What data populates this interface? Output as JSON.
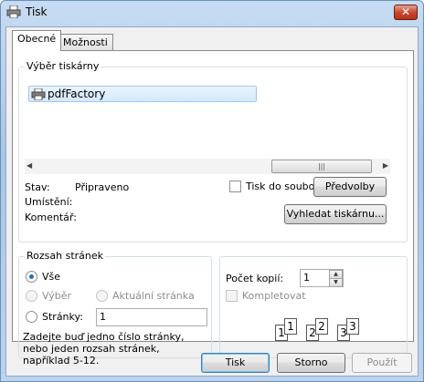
{
  "window": {
    "title": "Tisk",
    "close_glyph": "✕"
  },
  "tabs": [
    {
      "label": "Obecné",
      "active": true
    },
    {
      "label": "Možnosti",
      "active": false
    }
  ],
  "printer_group": {
    "title": "Výběr tiskárny",
    "printers": [
      {
        "label": "pdfFactory",
        "selected": true
      }
    ],
    "scroll_thumb_glyph": "|||",
    "status_label": "Stav:",
    "status_value": "Připraveno",
    "location_label": "Umístění:",
    "comment_label": "Komentář:",
    "print_to_file_label": "Tisk do souboru",
    "print_to_file_checked": false,
    "preferences_button": "Předvolby",
    "find_printer_button": "Vyhledat tiskárnu..."
  },
  "range_group": {
    "title": "Rozsah stránek",
    "all_label": "Vše",
    "selection_label": "Výběr",
    "current_page_label": "Aktuální stránka",
    "pages_label": "Stránky:",
    "pages_value": "1",
    "selected": "all",
    "hint": "Zadejte buď jedno číslo stránky, nebo jeden rozsah stránek, například 5-12."
  },
  "copies_group": {
    "copies_label": "Počet kopií:",
    "copies_value": "1",
    "collate_label": "Kompletovat",
    "collate_checked": false,
    "collate_pages": [
      "1",
      "1",
      "2",
      "2",
      "3",
      "3"
    ]
  },
  "footer": {
    "print_button": "Tisk",
    "cancel_button": "Storno",
    "apply_button": "Použít"
  }
}
